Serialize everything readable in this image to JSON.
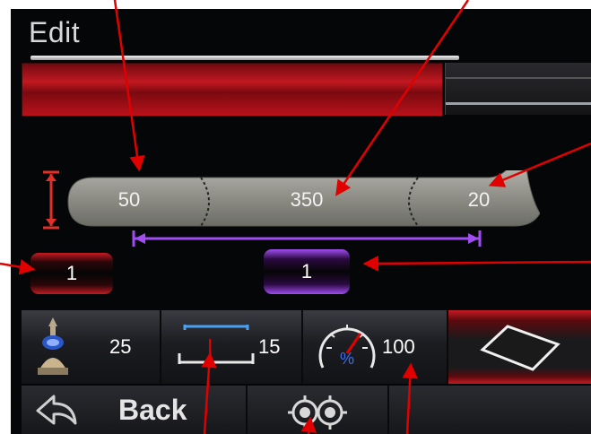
{
  "header": {
    "title": "Edit"
  },
  "shape": {
    "left_value": "50",
    "middle_value": "350",
    "right_value": "20"
  },
  "counters": {
    "left_count": "1",
    "center_count": "1"
  },
  "parameters": {
    "param1_value": "25",
    "param2_value": "15",
    "param3_value": "100"
  },
  "footer": {
    "back_label": "Back"
  },
  "colors": {
    "accent_red": "#c41a22",
    "accent_purple": "#a04cf0",
    "annotation_red": "#e00000"
  }
}
